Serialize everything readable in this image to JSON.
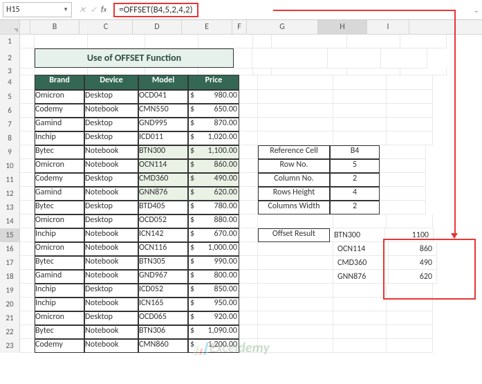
{
  "name_box": "H15",
  "formula": "=OFFSET(B4,5,2,4,2)",
  "columns": [
    "A",
    "B",
    "C",
    "D",
    "E",
    "F",
    "G",
    "H",
    "I"
  ],
  "title": "Use of OFFSET Function",
  "headers": {
    "brand": "Brand",
    "device": "Device",
    "model": "Model",
    "price": "Price"
  },
  "currency": "$",
  "rows": [
    {
      "n": 5,
      "brand": "Omicron",
      "device": "Desktop",
      "model": "OCD041",
      "price": "980.00"
    },
    {
      "n": 6,
      "brand": "Codemy",
      "device": "Notebook",
      "model": "CMN550",
      "price": "650.00"
    },
    {
      "n": 7,
      "brand": "Gamind",
      "device": "Desktop",
      "model": "GND995",
      "price": "870.00"
    },
    {
      "n": 8,
      "brand": "Inchip",
      "device": "Desktop",
      "model": "ICD011",
      "price": "1,020.00"
    },
    {
      "n": 9,
      "brand": "Bytec",
      "device": "Notebook",
      "model": "BTN300",
      "price": "1,100.00",
      "hl": true
    },
    {
      "n": 10,
      "brand": "Omicron",
      "device": "Notebook",
      "model": "OCN114",
      "price": "860.00",
      "hl": true
    },
    {
      "n": 11,
      "brand": "Codemy",
      "device": "Desktop",
      "model": "CMD360",
      "price": "490.00",
      "hl": true
    },
    {
      "n": 12,
      "brand": "Gamind",
      "device": "Notebook",
      "model": "GNN876",
      "price": "620.00",
      "hl": true
    },
    {
      "n": 13,
      "brand": "Bytec",
      "device": "Desktop",
      "model": "BTD405",
      "price": "780.00"
    },
    {
      "n": 14,
      "brand": "Omicron",
      "device": "Desktop",
      "model": "OCD052",
      "price": "880.00"
    },
    {
      "n": 15,
      "brand": "Inchip",
      "device": "Notebook",
      "model": "ICN142",
      "price": "670.00"
    },
    {
      "n": 16,
      "brand": "Omicron",
      "device": "Notebook",
      "model": "OCN116",
      "price": "1,000.00"
    },
    {
      "n": 17,
      "brand": "Bytec",
      "device": "Notebook",
      "model": "BTN305",
      "price": "990.00"
    },
    {
      "n": 18,
      "brand": "Gamind",
      "device": "Notebook",
      "model": "GND967",
      "price": "800.00"
    },
    {
      "n": 19,
      "brand": "Inchip",
      "device": "Desktop",
      "model": "ICD052",
      "price": "850.00"
    },
    {
      "n": 20,
      "brand": "Inchip",
      "device": "Notebook",
      "model": "ICN165",
      "price": "950.00"
    },
    {
      "n": 21,
      "brand": "Omicron",
      "device": "Desktop",
      "model": "OCD065",
      "price": "920.00"
    },
    {
      "n": 22,
      "brand": "Bytec",
      "device": "Notebook",
      "model": "BTN306",
      "price": "1,090.00"
    },
    {
      "n": 23,
      "brand": "Codemy",
      "device": "Notebook",
      "model": "CMN860",
      "price": "1,200.00"
    }
  ],
  "params": [
    {
      "label": "Reference Cell",
      "value": "B4"
    },
    {
      "label": "Row No.",
      "value": "5"
    },
    {
      "label": "Column No.",
      "value": "2"
    },
    {
      "label": "Rows Height",
      "value": "4"
    },
    {
      "label": "Columns Width",
      "value": "2"
    }
  ],
  "result_label": "Offset Result",
  "result": [
    {
      "model": "BTN300",
      "price": "1100"
    },
    {
      "model": "OCN114",
      "price": "860"
    },
    {
      "model": "CMD360",
      "price": "490"
    },
    {
      "model": "GNN876",
      "price": "620"
    }
  ],
  "watermark_a": "Excel",
  "watermark_b": "demy"
}
